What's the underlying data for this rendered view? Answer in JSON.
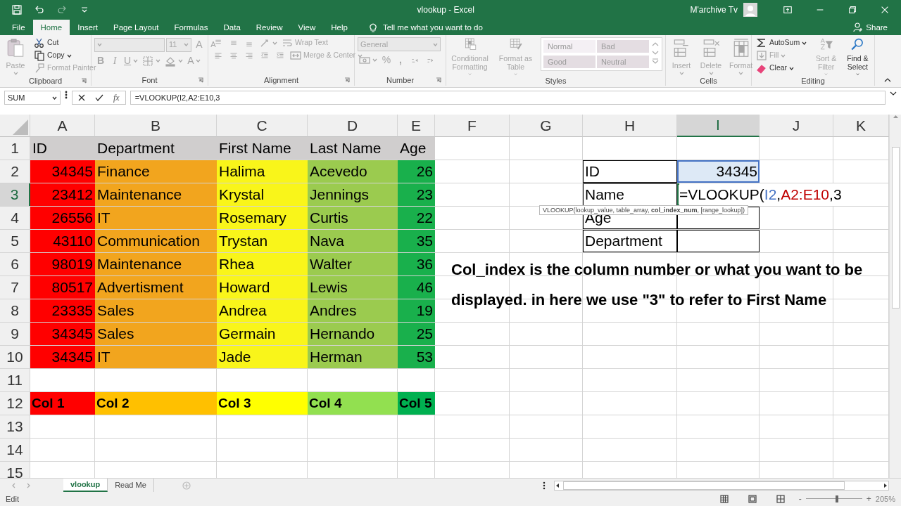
{
  "title_bar": {
    "title": "vlookup - Excel",
    "user": "M'archive Tv"
  },
  "ribbon_tabs": [
    {
      "label": "File",
      "selected": false
    },
    {
      "label": "Home",
      "selected": true
    },
    {
      "label": "Insert",
      "selected": false
    },
    {
      "label": "Page Layout",
      "selected": false
    },
    {
      "label": "Formulas",
      "selected": false
    },
    {
      "label": "Data",
      "selected": false
    },
    {
      "label": "Review",
      "selected": false
    },
    {
      "label": "View",
      "selected": false
    },
    {
      "label": "Help",
      "selected": false
    }
  ],
  "tell_me": "Tell me what you want to do",
  "share": "Share",
  "ribbon_groups": [
    {
      "label": "Clipboard",
      "launcher": true,
      "cols": [
        {
          "rows": [
            [
              {
                "kind": "large",
                "label": "Paste",
                "caret": true,
                "disabled": true
              }
            ]
          ]
        },
        {
          "rows": [
            [
              {
                "kind": "small",
                "label": "Cut",
                "disabled": false
              }
            ],
            [
              {
                "kind": "small",
                "label": "Copy",
                "caret": true,
                "disabled": false
              }
            ],
            [
              {
                "kind": "small",
                "label": "Format Painter",
                "disabled": true
              }
            ]
          ]
        }
      ]
    },
    {
      "label": "Font",
      "launcher": true,
      "cols": [
        {
          "rows": [
            [
              {
                "kind": "select",
                "disabled": true
              },
              {
                "kind": "select",
                "value": "11",
                "disabled": true
              },
              {
                "kind": "glyph",
                "label": "A",
                "disabled": true
              },
              {
                "kind": "glyph",
                "label": "A",
                "disabled": true
              }
            ],
            [
              {
                "kind": "glyph",
                "label": "B",
                "disabled": true
              },
              {
                "kind": "glyph",
                "label": "I",
                "disabled": true
              },
              {
                "kind": "glyph",
                "label": "U",
                "caret": true,
                "disabled": true
              },
              {
                "kind": "icon",
                "caret": true,
                "disabled": true
              },
              {
                "kind": "icon",
                "caret": true,
                "disabled": true
              },
              {
                "kind": "glyph",
                "label": "A",
                "caret": true,
                "disabled": true
              }
            ]
          ]
        }
      ]
    },
    {
      "label": "Alignment",
      "launcher": true,
      "cols": [
        {
          "rows": [
            [
              {
                "kind": "icon",
                "disabled": true
              },
              {
                "kind": "icon",
                "disabled": true
              },
              {
                "kind": "icon",
                "disabled": true
              },
              {
                "kind": "icon",
                "caret": true,
                "disabled": true
              },
              {
                "kind": "small",
                "label": "Wrap Text",
                "disabled": true
              }
            ],
            [
              {
                "kind": "icon",
                "disabled": true
              },
              {
                "kind": "icon",
                "disabled": true
              },
              {
                "kind": "icon",
                "disabled": true
              },
              {
                "kind": "icon",
                "disabled": true
              },
              {
                "kind": "icon",
                "disabled": true
              },
              {
                "kind": "small",
                "label": "Merge & Center",
                "caret": true,
                "disabled": true
              }
            ]
          ]
        }
      ]
    },
    {
      "label": "Number",
      "launcher": true,
      "cols": [
        {
          "rows": [
            [
              {
                "kind": "select",
                "value": "General",
                "disabled": true
              }
            ],
            [
              {
                "kind": "icon",
                "caret": true,
                "disabled": true
              },
              {
                "kind": "glyph",
                "label": "%",
                "disabled": true
              },
              {
                "kind": "glyph",
                "label": ",",
                "disabled": true
              },
              {
                "kind": "icon",
                "disabled": true
              },
              {
                "kind": "icon",
                "disabled": true
              }
            ]
          ]
        }
      ]
    },
    {
      "label": "Styles",
      "launcher": false,
      "cols": [
        {
          "rows": [
            [
              {
                "kind": "large",
                "label": "Conditional Formatting",
                "caret": true,
                "disabled": true
              }
            ]
          ]
        },
        {
          "rows": [
            [
              {
                "kind": "large",
                "label": "Format as Table",
                "caret": true,
                "disabled": true
              }
            ]
          ]
        },
        {
          "kind": "gallery",
          "rows": [
            [
              {
                "kind": "style",
                "label": "Normal",
                "color": "#f4f0f4",
                "disabled": true
              },
              {
                "kind": "style",
                "label": "Bad",
                "color": "#e4dde2",
                "disabled": true
              }
            ],
            [
              {
                "kind": "style",
                "label": "Good",
                "color": "#e4dde2",
                "disabled": true
              },
              {
                "kind": "style",
                "label": "Neutral",
                "color": "#e4dde2",
                "disabled": true
              }
            ]
          ]
        }
      ]
    },
    {
      "label": "Cells",
      "launcher": false,
      "cols": [
        {
          "rows": [
            [
              {
                "kind": "large",
                "label": "Insert",
                "caret": true,
                "disabled": true
              }
            ]
          ]
        },
        {
          "rows": [
            [
              {
                "kind": "large",
                "label": "Delete",
                "caret": true,
                "disabled": true
              }
            ]
          ]
        },
        {
          "rows": [
            [
              {
                "kind": "large",
                "label": "Format",
                "caret": true,
                "disabled": true
              }
            ]
          ]
        }
      ]
    },
    {
      "label": "Editing",
      "launcher": false,
      "cols": [
        {
          "rows": [
            [
              {
                "kind": "small",
                "label": "AutoSum",
                "caret": true,
                "disabled": false
              }
            ],
            [
              {
                "kind": "small",
                "label": "Fill",
                "caret": true,
                "disabled": true
              }
            ],
            [
              {
                "kind": "small",
                "label": "Clear",
                "caret": true,
                "disabled": false
              }
            ]
          ]
        },
        {
          "rows": [
            [
              {
                "kind": "large",
                "label": "Sort & Filter",
                "caret": true,
                "disabled": true
              }
            ]
          ]
        },
        {
          "rows": [
            [
              {
                "kind": "large",
                "label": "Find & Select",
                "caret": true,
                "disabled": false
              }
            ]
          ]
        }
      ]
    }
  ],
  "formula_bar": {
    "name_box": "SUM",
    "fx": "fx",
    "formula": "=VLOOKUP(I2,A2:E10,3"
  },
  "columns": [
    {
      "label": "A",
      "selected": false
    },
    {
      "label": "B",
      "selected": false
    },
    {
      "label": "C",
      "selected": false
    },
    {
      "label": "D",
      "selected": false
    },
    {
      "label": "E",
      "selected": false
    },
    {
      "label": "F",
      "selected": false
    },
    {
      "label": "G",
      "selected": false
    },
    {
      "label": "H",
      "selected": false
    },
    {
      "label": "I",
      "selected": true
    },
    {
      "label": "J",
      "selected": false
    },
    {
      "label": "K",
      "selected": false
    }
  ],
  "rows": [
    {
      "label": "1",
      "selected": false,
      "cells": [
        {
          "text": "ID",
          "kind": "text",
          "color": "#d0cece"
        },
        {
          "text": "Department",
          "kind": "text",
          "color": "#d0cece"
        },
        {
          "text": "First Name",
          "kind": "text",
          "color": "#d0cece"
        },
        {
          "text": "Last Name",
          "kind": "text",
          "color": "#d0cece"
        },
        {
          "text": "Age",
          "kind": "text",
          "color": "#d0cece"
        },
        {},
        {},
        {},
        {},
        {},
        {}
      ]
    },
    {
      "label": "2",
      "selected": false,
      "cells": [
        {
          "text": "34345",
          "kind": "number",
          "color": "#ff0000"
        },
        {
          "text": "Finance",
          "kind": "text",
          "color": "#f2a51e"
        },
        {
          "text": "Halima",
          "kind": "text",
          "color": "#f9f51a"
        },
        {
          "text": "Acevedo",
          "kind": "text",
          "color": "#9bcb4f"
        },
        {
          "text": "26",
          "kind": "number",
          "color": "#19b04c"
        },
        {},
        {},
        {
          "text": "ID",
          "kind": "text",
          "bordered": true
        },
        {
          "text": "34345",
          "kind": "number",
          "bordered": true,
          "color": "#dde9f6",
          "referenced": true
        },
        {},
        {}
      ]
    },
    {
      "label": "3",
      "selected": true,
      "cells": [
        {
          "text": "23412",
          "kind": "number",
          "color": "#ff0000"
        },
        {
          "text": "Maintenance",
          "kind": "text",
          "color": "#f2a51e"
        },
        {
          "text": "Krystal",
          "kind": "text",
          "color": "#f9f51a"
        },
        {
          "text": "Jennings",
          "kind": "text",
          "color": "#9bcb4f"
        },
        {
          "text": "23",
          "kind": "number",
          "color": "#19b04c"
        },
        {},
        {},
        {
          "text": "Name",
          "kind": "text",
          "bordered": true
        },
        {
          "kind": "formula",
          "bordered": true,
          "editing": true,
          "segments": [
            {
              "text": "=VLOOKUP(",
              "color": "#000000"
            },
            {
              "text": "I2",
              "color": "#4472c4"
            },
            {
              "text": ",",
              "color": "#000000"
            },
            {
              "text": "A2:E10",
              "color": "#c00000"
            },
            {
              "text": ",3",
              "color": "#000000"
            }
          ]
        },
        {},
        {}
      ]
    },
    {
      "label": "4",
      "selected": false,
      "cells": [
        {
          "text": "26556",
          "kind": "number",
          "color": "#ff0000"
        },
        {
          "text": "IT",
          "kind": "text",
          "color": "#f2a51e"
        },
        {
          "text": "Rosemary",
          "kind": "text",
          "color": "#f9f51a"
        },
        {
          "text": "Curtis",
          "kind": "text",
          "color": "#9bcb4f"
        },
        {
          "text": "22",
          "kind": "number",
          "color": "#19b04c"
        },
        {},
        {},
        {
          "text": "Age",
          "kind": "text",
          "bordered": true
        },
        {
          "bordered": true
        },
        {},
        {}
      ]
    },
    {
      "label": "5",
      "selected": false,
      "cells": [
        {
          "text": "43110",
          "kind": "number",
          "color": "#ff0000"
        },
        {
          "text": "Communication",
          "kind": "text",
          "color": "#f2a51e"
        },
        {
          "text": "Trystan",
          "kind": "text",
          "color": "#f9f51a"
        },
        {
          "text": "Nava",
          "kind": "text",
          "color": "#9bcb4f"
        },
        {
          "text": "35",
          "kind": "number",
          "color": "#19b04c"
        },
        {},
        {},
        {
          "text": "Department",
          "kind": "text",
          "bordered": true
        },
        {
          "bordered": true
        },
        {},
        {}
      ]
    },
    {
      "label": "6",
      "selected": false,
      "cells": [
        {
          "text": "98019",
          "kind": "number",
          "color": "#ff0000"
        },
        {
          "text": "Maintenance",
          "kind": "text",
          "color": "#f2a51e"
        },
        {
          "text": "Rhea",
          "kind": "text",
          "color": "#f9f51a"
        },
        {
          "text": "Walter",
          "kind": "text",
          "color": "#9bcb4f"
        },
        {
          "text": "36",
          "kind": "number",
          "color": "#19b04c"
        },
        {},
        {},
        {},
        {},
        {},
        {}
      ]
    },
    {
      "label": "7",
      "selected": false,
      "cells": [
        {
          "text": "80517",
          "kind": "number",
          "color": "#ff0000"
        },
        {
          "text": "Advertisment",
          "kind": "text",
          "color": "#f2a51e"
        },
        {
          "text": "Howard",
          "kind": "text",
          "color": "#f9f51a"
        },
        {
          "text": "Lewis",
          "kind": "text",
          "color": "#9bcb4f"
        },
        {
          "text": "46",
          "kind": "number",
          "color": "#19b04c"
        },
        {},
        {},
        {},
        {},
        {},
        {}
      ]
    },
    {
      "label": "8",
      "selected": false,
      "cells": [
        {
          "text": "23335",
          "kind": "number",
          "color": "#ff0000"
        },
        {
          "text": "Sales",
          "kind": "text",
          "color": "#f2a51e"
        },
        {
          "text": "Andrea",
          "kind": "text",
          "color": "#f9f51a"
        },
        {
          "text": "Andres",
          "kind": "text",
          "color": "#9bcb4f"
        },
        {
          "text": "19",
          "kind": "number",
          "color": "#19b04c"
        },
        {},
        {},
        {},
        {},
        {},
        {}
      ]
    },
    {
      "label": "9",
      "selected": false,
      "cells": [
        {
          "text": "34345",
          "kind": "number",
          "color": "#ff0000"
        },
        {
          "text": "Sales",
          "kind": "text",
          "color": "#f2a51e"
        },
        {
          "text": "Germain",
          "kind": "text",
          "color": "#f9f51a"
        },
        {
          "text": "Hernando",
          "kind": "text",
          "color": "#9bcb4f"
        },
        {
          "text": "25",
          "kind": "number",
          "color": "#19b04c"
        },
        {},
        {},
        {},
        {},
        {},
        {}
      ]
    },
    {
      "label": "10",
      "selected": false,
      "cells": [
        {
          "text": "34345",
          "kind": "number",
          "color": "#ff0000"
        },
        {
          "text": "IT",
          "kind": "text",
          "color": "#f2a51e"
        },
        {
          "text": "Jade",
          "kind": "text",
          "color": "#f9f51a"
        },
        {
          "text": "Herman",
          "kind": "text",
          "color": "#9bcb4f"
        },
        {
          "text": "53",
          "kind": "number",
          "color": "#19b04c"
        },
        {},
        {},
        {},
        {},
        {},
        {}
      ]
    },
    {
      "label": "11",
      "selected": false,
      "cells": [
        {},
        {},
        {},
        {},
        {},
        {},
        {},
        {},
        {},
        {},
        {}
      ]
    },
    {
      "label": "12",
      "selected": false,
      "cells": [
        {
          "text": "Col 1",
          "kind": "label",
          "color": "#ff0000"
        },
        {
          "text": "Col 2",
          "kind": "label",
          "color": "#ffc000"
        },
        {
          "text": "Col 3",
          "kind": "label",
          "color": "#ffff00"
        },
        {
          "text": "Col 4",
          "kind": "label",
          "color": "#92e050"
        },
        {
          "text": "Col 5",
          "kind": "label",
          "color": "#00b050"
        },
        {},
        {},
        {},
        {},
        {},
        {}
      ]
    },
    {
      "label": "13",
      "selected": false,
      "cells": [
        {},
        {},
        {},
        {},
        {},
        {},
        {},
        {},
        {},
        {},
        {}
      ]
    },
    {
      "label": "14",
      "selected": false,
      "cells": [
        {},
        {},
        {},
        {},
        {},
        {},
        {},
        {},
        {},
        {},
        {}
      ]
    },
    {
      "label": "15",
      "selected": false,
      "cells": [
        {},
        {},
        {},
        {},
        {},
        {},
        {},
        {},
        {},
        {},
        {}
      ]
    }
  ],
  "tooltip": "VLOOKUP(lookup_value, table_array, **col_index_num**, [range_lookup])",
  "text_box": "Col_index is the column number or what you want to be displayed. in here we use \"3\" to refer to First Name",
  "sheet_tabs": [
    {
      "label": "vlookup",
      "selected": true
    },
    {
      "label": "Read Me",
      "selected": false
    }
  ],
  "status_bar": {
    "mode": "Edit",
    "zoom_out": "-",
    "zoom_in": "+",
    "zoom": {
      "level": 0.55,
      "text": "205%"
    }
  }
}
